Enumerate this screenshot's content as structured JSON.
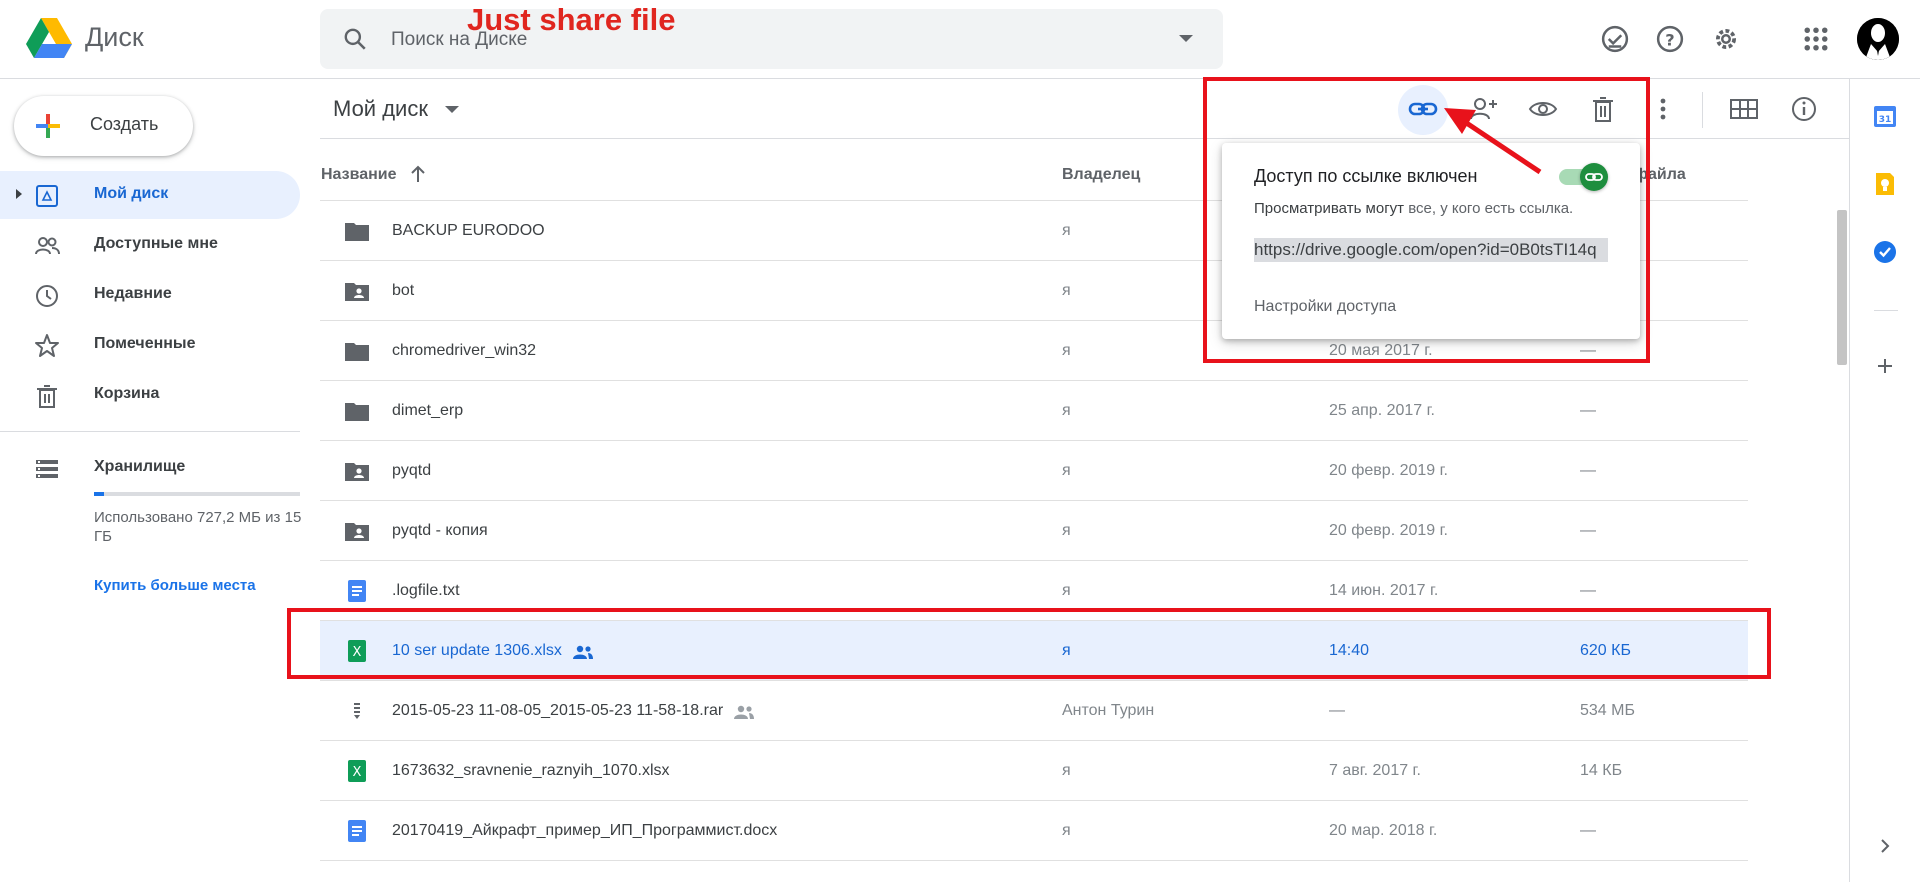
{
  "header": {
    "app_name": "Диск",
    "search_placeholder": "Поиск на Диске",
    "annotation": "Just share file"
  },
  "sidebar": {
    "create_label": "Создать",
    "items": [
      {
        "label": "Мой диск",
        "icon": "my-drive-icon",
        "active": true
      },
      {
        "label": "Доступные мне",
        "icon": "people-icon"
      },
      {
        "label": "Недавние",
        "icon": "clock-icon"
      },
      {
        "label": "Помеченные",
        "icon": "star-icon"
      },
      {
        "label": "Корзина",
        "icon": "trash-icon"
      }
    ],
    "storage": {
      "label": "Хранилище",
      "usage_text": "Использовано 727,2 МБ из 15 ГБ",
      "used_fraction": 0.047,
      "buy_label": "Купить больше места"
    }
  },
  "main": {
    "title": "Мой диск",
    "columns": {
      "name": "Название",
      "owner": "Владелец",
      "size_partial": "файла"
    },
    "rows": [
      {
        "name": "BACKUP EURODOO",
        "type": "folder",
        "owner": "я",
        "modified": "",
        "size": ""
      },
      {
        "name": "bot",
        "type": "shared-folder",
        "owner": "я",
        "modified": "",
        "size": ""
      },
      {
        "name": "chromedriver_win32",
        "type": "folder",
        "owner": "я",
        "modified": "20 мая 2017 г.",
        "size": "—"
      },
      {
        "name": "dimet_erp",
        "type": "folder",
        "owner": "я",
        "modified": "25 апр. 2017 г.",
        "size": "—"
      },
      {
        "name": "pyqtd",
        "type": "shared-folder",
        "owner": "я",
        "modified": "20 февр. 2019 г.",
        "size": "—"
      },
      {
        "name": "pyqtd - копия",
        "type": "shared-folder",
        "owner": "я",
        "modified": "20 февр. 2019 г.",
        "size": "—"
      },
      {
        "name": ".logfile.txt",
        "type": "doc",
        "owner": "я",
        "modified": "14 июн. 2017 г.",
        "size": "—"
      },
      {
        "name": "10 ser update 1306.xlsx",
        "type": "sheet",
        "owner": "я",
        "modified": "14:40",
        "size": "620 КБ",
        "selected": true,
        "shared": true
      },
      {
        "name": "2015-05-23 11-08-05_2015-05-23 11-58-18.rar",
        "type": "archive",
        "owner": "Антон Турин",
        "modified": "—",
        "size": "534 МБ",
        "shared": true
      },
      {
        "name": "1673632_sravnenie_raznyih_1070.xlsx",
        "type": "sheet",
        "owner": "я",
        "modified": "7 авг. 2017 г.",
        "size": "14 КБ"
      },
      {
        "name": "20170419_Айкрафт_пример_ИП_Программист.docx",
        "type": "doc",
        "owner": "я",
        "modified": "20 мар. 2018 г.",
        "size": "—"
      }
    ]
  },
  "popup": {
    "title": "Доступ по ссылке включен",
    "viewers_prefix": "Просматривать могут",
    "viewers_suffix": "все, у кого есть ссылка.",
    "link": "https://drive.google.com/open?id=0B0tsTI14q",
    "settings_label": "Настройки доступа",
    "toggle_on": true
  },
  "colors": {
    "accent": "#1a73e8",
    "selected_bg": "#e8f0fe",
    "annotation_red": "#e8121b",
    "toggle_green": "#1e8e3e"
  }
}
